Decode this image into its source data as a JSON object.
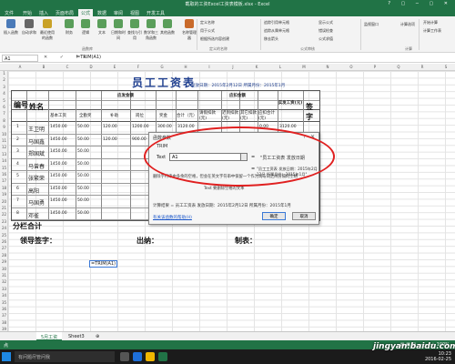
{
  "window": {
    "title": "截取的工资Excel工资表模板.xlsx - Excel",
    "controls": "? ▢ ─ ▢ ✕"
  },
  "ribbon": {
    "tabs": [
      "文件",
      "开始",
      "插入",
      "页面布局",
      "公式",
      "数据",
      "审阅",
      "视图",
      "开发工具"
    ],
    "active_tab": "公式",
    "buttons": [
      {
        "label": "插入函数",
        "icon": "fx-icon",
        "color": "#4a7ab8"
      },
      {
        "label": "自动求和",
        "icon": "sigma-icon",
        "color": "#666666"
      },
      {
        "label": "最近使用的函数",
        "icon": "star-icon",
        "color": "#c9a227"
      },
      {
        "label": "财务",
        "icon": "book-icon",
        "color": "#5a9e5a"
      },
      {
        "label": "逻辑",
        "icon": "book-icon",
        "color": "#5a9e5a"
      },
      {
        "label": "文本",
        "icon": "book-icon",
        "color": "#5a9e5a"
      },
      {
        "label": "日期和时间",
        "icon": "book-icon",
        "color": "#5a9e5a"
      },
      {
        "label": "查找与引用",
        "icon": "book-icon",
        "color": "#5a9e5a"
      },
      {
        "label": "数学和三角函数",
        "icon": "book-icon",
        "color": "#5a9e5a"
      },
      {
        "label": "其他函数",
        "icon": "book-icon",
        "color": "#5a9e5a"
      },
      {
        "label": "名称管理器",
        "icon": "tag-icon",
        "color": "#c96a2a"
      }
    ],
    "small_buttons": [
      "定义名称",
      "用于公式",
      "根据所选内容创建",
      "追踪引用单元格",
      "追踪从属单元格",
      "移去箭头",
      "显示公式",
      "错误检查",
      "公式求值",
      "监视窗口",
      "计算选项",
      "开始计算",
      "计算工作表"
    ],
    "groups": [
      "函数库",
      "定义的名称",
      "公式审核",
      "计算"
    ]
  },
  "formula_bar": {
    "name_box": "A1",
    "icons": "✕ ✓ fx",
    "content": "=TRIM(A1)"
  },
  "columns": [
    "A",
    "B",
    "C",
    "D",
    "E",
    "F",
    "G",
    "H",
    "I",
    "J",
    "K",
    "L",
    "M",
    "N",
    "O",
    "P",
    "Q",
    "R",
    "S"
  ],
  "rows": [
    "1",
    "2",
    "3",
    "4",
    "5",
    "6",
    "7",
    "8",
    "9",
    "10",
    "11",
    "12",
    "13",
    "14",
    "15",
    "16",
    "17",
    "18",
    "19",
    "20",
    "21",
    "22",
    "23",
    "24",
    "25",
    "26",
    "27",
    "28",
    "29",
    "30",
    "31",
    "32",
    "33",
    "34",
    "35",
    "36",
    "37",
    "38",
    "39"
  ],
  "sheet": {
    "title": "员工工资表",
    "date_line": "发放日期：2015年2月12日  所属月份：2015年1月",
    "col_no": "编号",
    "col_name": "姓名",
    "group_payable": "应发金额",
    "group_deduct": "应扣金额",
    "col_actual": "实发工资(元)",
    "col_sign": "签字",
    "sub_headers": [
      "基本工资",
      "全勤奖",
      "补助",
      "岗位",
      "奖金",
      "合计（元）",
      "请假扣款(元)",
      "迟到扣款(元)",
      "其它扣款(元)",
      "应扣合计(元)"
    ],
    "rows": [
      {
        "no": "1",
        "name": "王卫明",
        "base": "1450.00",
        "full": "50.00",
        "sub": "120.00",
        "post": "1200.00",
        "bonus": "300.00",
        "total": "3120.00",
        "leave": "",
        "late": "",
        "other": "",
        "deduct": "0.00",
        "actual": "3120.00"
      },
      {
        "no": "2",
        "name": "马国鑫",
        "base": "1450.00",
        "full": "50.00",
        "sub": "120.00",
        "post": "900.00",
        "bonus": "300.00",
        "total": "",
        "leave": "",
        "late": "",
        "other": "",
        "deduct": "",
        "actual": ""
      },
      {
        "no": "3",
        "name": "郑国斌",
        "base": "1450.00",
        "full": "50.00",
        "sub": "",
        "post": "",
        "bonus": "",
        "total": "",
        "leave": "",
        "late": "",
        "other": "",
        "deduct": "",
        "actual": ""
      },
      {
        "no": "4",
        "name": "马曾春",
        "base": "1450.00",
        "full": "50.00",
        "sub": "",
        "post": "",
        "bonus": "",
        "total": "",
        "leave": "",
        "late": "",
        "other": "",
        "deduct": "",
        "actual": ""
      },
      {
        "no": "5",
        "name": "张繁荣",
        "base": "1450.00",
        "full": "50.00",
        "sub": "",
        "post": "",
        "bonus": "",
        "total": "",
        "leave": "",
        "late": "",
        "other": "",
        "deduct": "",
        "actual": ""
      },
      {
        "no": "6",
        "name": "高阳",
        "base": "1450.00",
        "full": "50.00",
        "sub": "",
        "post": "",
        "bonus": "",
        "total": "",
        "leave": "",
        "late": "",
        "other": "",
        "deduct": "",
        "actual": ""
      },
      {
        "no": "7",
        "name": "马国勇",
        "base": "1450.00",
        "full": "50.00",
        "sub": "",
        "post": "",
        "bonus": "",
        "total": "",
        "leave": "",
        "late": "",
        "other": "",
        "deduct": "",
        "actual": ""
      },
      {
        "no": "8",
        "name": "邓雀",
        "base": "1450.00",
        "full": "50.00",
        "sub": "",
        "post": "",
        "bonus": "",
        "total": "",
        "leave": "",
        "late": "",
        "other": "",
        "deduct": "",
        "actual": ""
      }
    ],
    "subtotal": "分栏合计",
    "leader_sign": "领导签字：",
    "cashier": "出纳：",
    "maker": "制表：",
    "formula_cell": "=TRIM(A1)"
  },
  "dialog": {
    "title": "函数参数",
    "help": "?",
    "close": "✕",
    "function_name": "TRIM",
    "arg_label": "Text",
    "arg_value": "A1",
    "equals": "=",
    "arg_preview": "\"员工工资表  发放日期",
    "result_preview": "\"员工工资表  发放日期：2015年2月12日 所属月份：2015年1月\"",
    "description": "删除字符串中多余的空格，但会在英文字符串中保留一个作为词与词之间分隔的空格",
    "description2": "Text  要删除空格的文本",
    "calc_result": "计算结果 =  员工工资表  发放日期：2015年2月12日 所属月份：2015年1月",
    "help_link": "有关该函数的帮助(H)",
    "ok": "确定",
    "cancel": "取消"
  },
  "sheet_tabs": [
    "5月工资",
    "Sheet3",
    "⊕"
  ],
  "status": {
    "left": "点",
    "right": "▦ ▣ ▤  ─────+  100%"
  },
  "taskbar": {
    "cortana": "有问题尽管问我",
    "time": "10:23",
    "date": "2016-02-25"
  },
  "watermark": "jingyan.baidu.com"
}
